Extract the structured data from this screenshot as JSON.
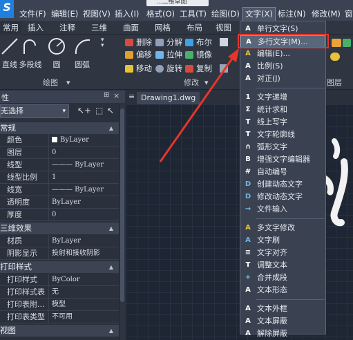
{
  "app": {
    "logo_text": "S"
  },
  "colors": {
    "accent": "#1f7fe0",
    "annotation": "#e8352a"
  },
  "titlebar": {
    "title": "...二维草图"
  },
  "menubar": {
    "items": [
      "文件(F)",
      "编辑(E)",
      "视图(V)",
      "插入(I)",
      "格式(O)",
      "工具(T)",
      "绘图(D)",
      "文字(X)",
      "标注(N)",
      "修改(M)",
      "窗"
    ]
  },
  "ribbon_tabs": [
    "常用",
    "插入",
    "注释",
    "三维",
    "曲面",
    "网格",
    "布局",
    "视图"
  ],
  "ribbon": {
    "draw_tools": [
      "直线",
      "多段线",
      "圆",
      "圆弧"
    ],
    "modify_tools": [
      "删除",
      "分解",
      "布尔",
      "偏移",
      "拉伸",
      "镜像",
      "移动",
      "旋转",
      "复制"
    ],
    "groups": {
      "draw": "绘图",
      "modify": "修改",
      "layer": "图层"
    }
  },
  "properties": {
    "selection": "无选择",
    "sections": [
      {
        "title": "常规",
        "rows": [
          {
            "k": "颜色",
            "v": "ByLayer"
          },
          {
            "k": "图层",
            "v": "0"
          },
          {
            "k": "线型",
            "v": "——— ByLayer"
          },
          {
            "k": "线型比例",
            "v": "1"
          },
          {
            "k": "线宽",
            "v": "——— ByLayer"
          },
          {
            "k": "透明度",
            "v": "ByLayer"
          },
          {
            "k": "厚度",
            "v": "0"
          }
        ]
      },
      {
        "title": "三维效果",
        "rows": [
          {
            "k": "材质",
            "v": "ByLayer"
          },
          {
            "k": "阴影显示",
            "v": "投射和接收阴影"
          }
        ]
      },
      {
        "title": "打印样式",
        "rows": [
          {
            "k": "打印样式",
            "v": "ByColor"
          },
          {
            "k": "打印样式表",
            "v": "无"
          },
          {
            "k": "打印表附...",
            "v": "模型"
          },
          {
            "k": "打印表类型",
            "v": "不可用"
          }
        ]
      },
      {
        "title": "视图",
        "rows": []
      }
    ]
  },
  "document": {
    "tab": "Drawing1.dwg"
  },
  "text_menu": {
    "items": [
      {
        "label": "单行文字(S)",
        "icon": "A"
      },
      {
        "label": "多行文字(M)...",
        "icon": "A"
      },
      {
        "label": "编辑(E)...",
        "icon": "A"
      },
      {
        "label": "比例(S)",
        "icon": "A"
      },
      {
        "label": "对正(J)",
        "icon": "A"
      },
      {
        "label": "文字递增",
        "icon": "1"
      },
      {
        "label": "统计求和",
        "icon": "Σ"
      },
      {
        "label": "线上写字",
        "icon": "T"
      },
      {
        "label": "文字轮廓线",
        "icon": "T"
      },
      {
        "label": "弧形文字",
        "icon": "∩"
      },
      {
        "label": "增强文字编辑器",
        "icon": "B"
      },
      {
        "label": "自动编号",
        "icon": "#"
      },
      {
        "label": "创建动态文字",
        "icon": "D"
      },
      {
        "label": "修改动态文字",
        "icon": "D"
      },
      {
        "label": "文件输入",
        "icon": "→"
      },
      {
        "label": "多文字修改",
        "icon": "A"
      },
      {
        "label": "文字刷",
        "icon": "A"
      },
      {
        "label": "文字对齐",
        "icon": "≡"
      },
      {
        "label": "调整文本",
        "icon": "T"
      },
      {
        "label": "合并成段",
        "icon": "+"
      },
      {
        "label": "文本形态",
        "icon": "A"
      },
      {
        "label": "文本外框",
        "icon": "A"
      },
      {
        "label": "文本屏蔽",
        "icon": "A"
      },
      {
        "label": "解除屏蔽",
        "icon": "A"
      }
    ]
  }
}
